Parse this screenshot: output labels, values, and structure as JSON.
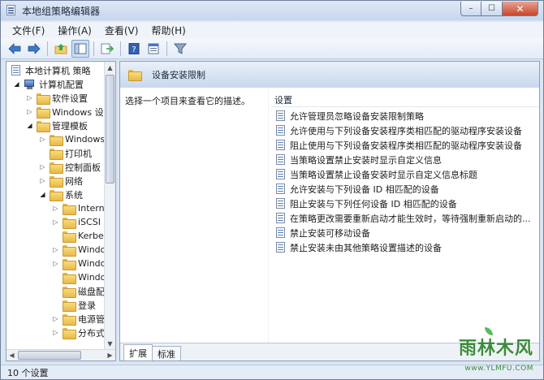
{
  "window": {
    "title": "本地组策略编辑器",
    "caption": {
      "minimize": "–",
      "maximize": "☐",
      "close": "✕"
    }
  },
  "menu": [
    {
      "label": "文件(F)"
    },
    {
      "label": "操作(A)"
    },
    {
      "label": "查看(V)"
    },
    {
      "label": "帮助(H)"
    }
  ],
  "toolbar": {
    "buttons": [
      "back-icon",
      "forward-icon",
      "up-folder-icon",
      "show-hide-tree-icon",
      "export-list-icon",
      "help-icon",
      "properties-icon",
      "filter-icon"
    ]
  },
  "tree": {
    "items": [
      {
        "label": "本地计算机 策略",
        "level": 0,
        "expander": "none",
        "icon": "policy-icon"
      },
      {
        "label": "计算机配置",
        "level": 1,
        "expander": "open",
        "icon": "computer-icon"
      },
      {
        "label": "软件设置",
        "level": 2,
        "expander": "closed",
        "icon": "folder-icon"
      },
      {
        "label": "Windows 设",
        "level": 2,
        "expander": "closed",
        "icon": "folder-icon"
      },
      {
        "label": "管理模板",
        "level": 2,
        "expander": "open",
        "icon": "folder-icon"
      },
      {
        "label": "Windows",
        "level": 3,
        "expander": "closed",
        "icon": "folder-icon"
      },
      {
        "label": "打印机",
        "level": 3,
        "expander": "none",
        "icon": "folder-icon"
      },
      {
        "label": "控制面板",
        "level": 3,
        "expander": "closed",
        "icon": "folder-icon"
      },
      {
        "label": "网络",
        "level": 3,
        "expander": "closed",
        "icon": "folder-icon"
      },
      {
        "label": "系统",
        "level": 3,
        "expander": "open",
        "icon": "folder-icon"
      },
      {
        "label": "Intern",
        "level": 4,
        "expander": "closed",
        "icon": "folder-icon"
      },
      {
        "label": "iSCSI",
        "level": 4,
        "expander": "closed",
        "icon": "folder-icon"
      },
      {
        "label": "Kerbe",
        "level": 4,
        "expander": "none",
        "icon": "folder-icon"
      },
      {
        "label": "Windo",
        "level": 4,
        "expander": "closed",
        "icon": "folder-icon"
      },
      {
        "label": "Windo",
        "level": 4,
        "expander": "closed",
        "icon": "folder-icon"
      },
      {
        "label": "Windo",
        "level": 4,
        "expander": "none",
        "icon": "folder-icon"
      },
      {
        "label": "磁盘配",
        "level": 4,
        "expander": "none",
        "icon": "folder-icon"
      },
      {
        "label": "登录",
        "level": 4,
        "expander": "none",
        "icon": "folder-icon"
      },
      {
        "label": "电源管",
        "level": 4,
        "expander": "closed",
        "icon": "folder-icon"
      },
      {
        "label": "分布式",
        "level": 4,
        "expander": "closed",
        "icon": "folder-icon"
      }
    ]
  },
  "right_pane": {
    "header_title": "设备安装限制",
    "description": "选择一个项目来查看它的描述。",
    "column_header": "设置",
    "settings": [
      "允许管理员忽略设备安装限制策略",
      "允许使用与下列设备安装程序类相匹配的驱动程序安装设备",
      "阻止使用与下列设备安装程序类相匹配的驱动程序安装设备",
      "当策略设置禁止安装时显示自定义信息",
      "当策略设置禁止设备安装时显示自定义信息标题",
      "允许安装与下列设备 ID 相匹配的设备",
      "阻止安装与下列任何设备 ID 相匹配的设备",
      "在策略更改需要重新启动才能生效时，等待强制重新启动的...",
      "禁止安装可移动设备",
      "禁止安装未由其他策略设置描述的设备"
    ],
    "tabs": [
      {
        "label": "扩展",
        "active": true
      },
      {
        "label": "标准",
        "active": false
      }
    ]
  },
  "status": {
    "text": "10 个设置"
  },
  "watermark": {
    "main": "雨林木风",
    "sub": "www.YLMFU.COM"
  }
}
